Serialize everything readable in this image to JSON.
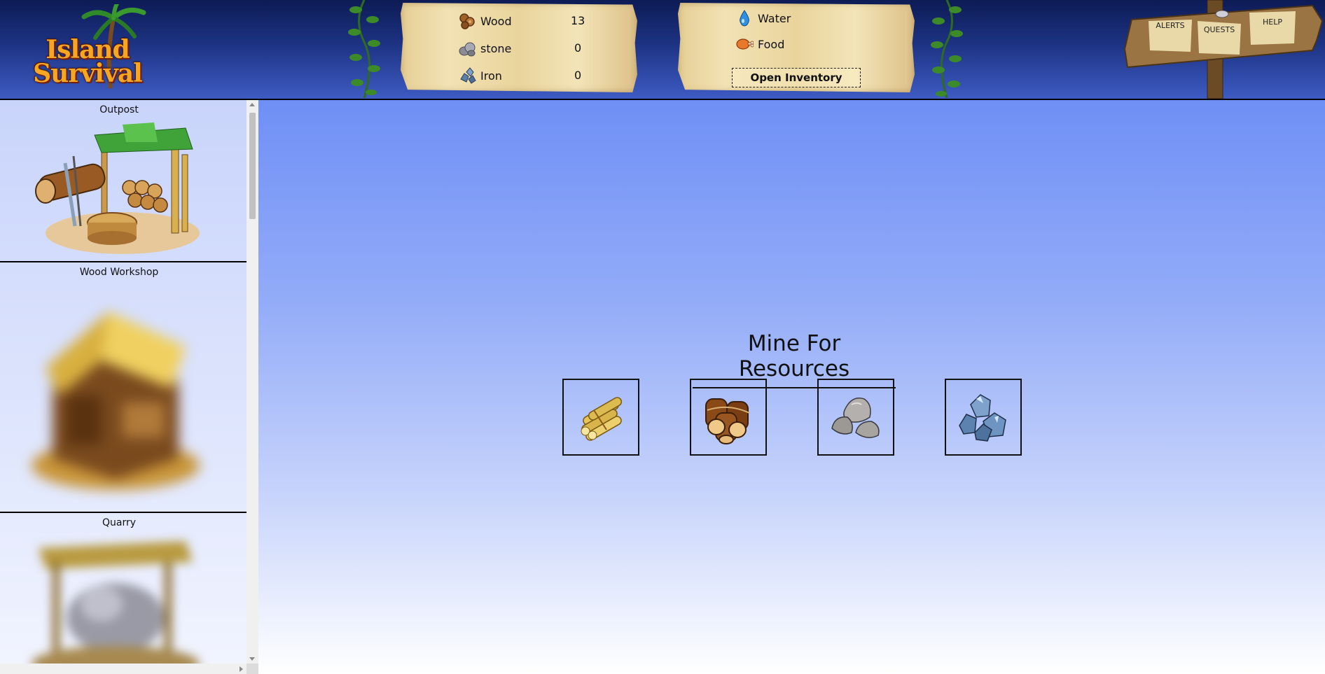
{
  "app": {
    "logo_line1": "Island",
    "logo_line2": "Survival"
  },
  "resources": [
    {
      "name": "Wood",
      "value": "13",
      "icon": "wood-icon"
    },
    {
      "name": "stone",
      "value": "0",
      "icon": "stone-icon"
    },
    {
      "name": "Iron",
      "value": "0",
      "icon": "iron-icon"
    }
  ],
  "needs": [
    {
      "name": "Water",
      "icon": "water-drop-icon"
    },
    {
      "name": "Food",
      "icon": "meat-icon"
    }
  ],
  "inventory_button": "Open Inventory",
  "signpost": {
    "alerts": "ALERTS",
    "quests": "QUESTS",
    "help": "HELP"
  },
  "buildings": [
    {
      "title": "Outpost",
      "state": "unlocked"
    },
    {
      "title": "Wood Workshop",
      "state": "locked"
    },
    {
      "title": "Quarry",
      "state": "locked"
    }
  ],
  "main": {
    "title": "Mine For Resources",
    "tiles": [
      "bamboo-icon",
      "logs-icon",
      "rocks-icon",
      "iron-ore-icon"
    ]
  },
  "colors": {
    "header_dark": "#0d1b55",
    "main_top": "#6f8ff5",
    "plank": "#e9d49c",
    "logo_orange": "#f5a623"
  }
}
